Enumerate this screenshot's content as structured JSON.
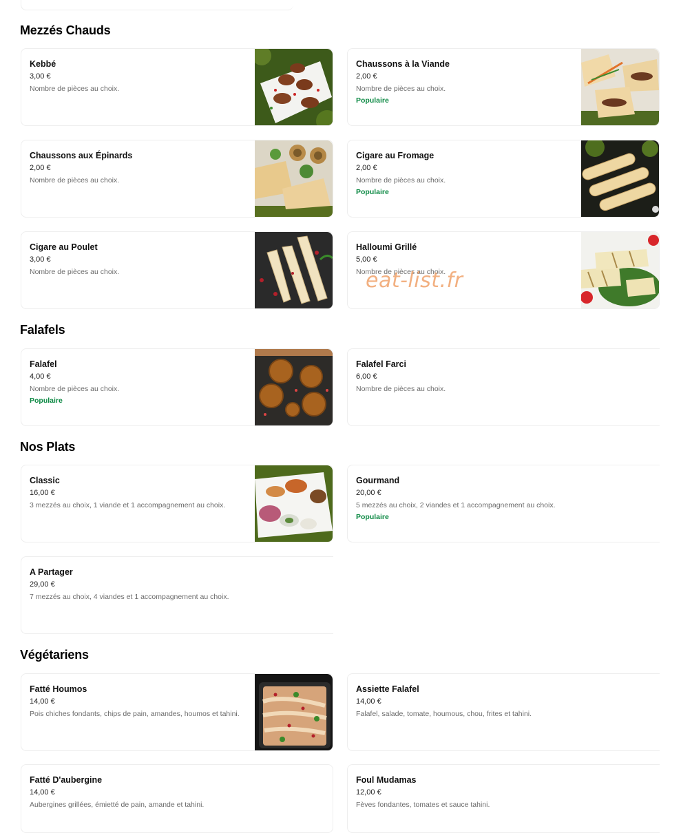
{
  "sections": [
    {
      "title": "Mezzés Chauds",
      "items": [
        {
          "name": "Kebbé",
          "price": "3,00 €",
          "description": "Nombre de pièces au choix.",
          "badge": ""
        },
        {
          "name": "Chaussons à la Viande",
          "price": "2,00 €",
          "description": "Nombre de pièces au choix.",
          "badge": "Populaire"
        },
        {
          "name": "Chaussons aux Épinards",
          "price": "2,00 €",
          "description": "Nombre de pièces au choix.",
          "badge": ""
        },
        {
          "name": "Cigare au Fromage",
          "price": "2,00 €",
          "description": "Nombre de pièces au choix.",
          "badge": "Populaire"
        },
        {
          "name": "Cigare au Poulet",
          "price": "3,00 €",
          "description": "Nombre de pièces au choix.",
          "badge": ""
        },
        {
          "name": "Halloumi Grillé",
          "price": "5,00 €",
          "description": "Nombre de pièces au choix.",
          "badge": ""
        }
      ]
    },
    {
      "title": "Falafels",
      "items": [
        {
          "name": "Falafel",
          "price": "4,00 €",
          "description": "Nombre de pièces au choix.",
          "badge": "Populaire"
        },
        {
          "name": "Falafel Farci",
          "price": "6,00 €",
          "description": "Nombre de pièces au choix.",
          "badge": ""
        }
      ]
    },
    {
      "title": "Nos Plats",
      "items": [
        {
          "name": "Classic",
          "price": "16,00 €",
          "description": "3 mezzés au choix, 1 viande et 1 accompagnement au choix.",
          "badge": ""
        },
        {
          "name": "Gourmand",
          "price": "20,00 €",
          "description": "5 mezzés au choix, 2 viandes et 1 accompagnement au choix.",
          "badge": "Populaire"
        },
        {
          "name": "A Partager",
          "price": "29,00 €",
          "description": "7 mezzés au choix, 4 viandes et 1 accompagnement au choix.",
          "badge": ""
        }
      ]
    },
    {
      "title": "Végétariens",
      "items": [
        {
          "name": "Fatté Houmos",
          "price": "14,00 €",
          "description": "Pois chiches fondants, chips de pain, amandes, houmos et tahini.",
          "badge": ""
        },
        {
          "name": "Assiette Falafel",
          "price": "14,00 €",
          "description": "Falafel, salade, tomate, houmous, chou, frites et tahini.",
          "badge": ""
        },
        {
          "name": "Fatté D'aubergine",
          "price": "14,00 €",
          "description": "Aubergines grillées, émietté de pain, amande et tahini.",
          "badge": ""
        },
        {
          "name": "Foul Mudamas",
          "price": "12,00 €",
          "description": "Fèves fondantes, tomates et sauce tahini.",
          "badge": ""
        }
      ]
    }
  ],
  "watermark": "eat-list.fr",
  "icons": {
    "kebbe": "kebbe-photo-icon",
    "chaussons_viande": "chaussons-viande-photo-icon",
    "chaussons_epinards": "chaussons-epinards-photo-icon",
    "cigare_fromage": "cigare-fromage-photo-icon",
    "cigare_poulet": "cigare-poulet-photo-icon",
    "halloumi": "halloumi-photo-icon",
    "falafel": "falafel-photo-icon",
    "classic": "classic-plate-photo-icon",
    "fatte_houmos": "fatte-houmos-photo-icon"
  },
  "colors": {
    "badge": "#0e8a45",
    "description": "#6b6b6b",
    "watermark": "#f0a36c",
    "card_border": "#eeeeee"
  }
}
